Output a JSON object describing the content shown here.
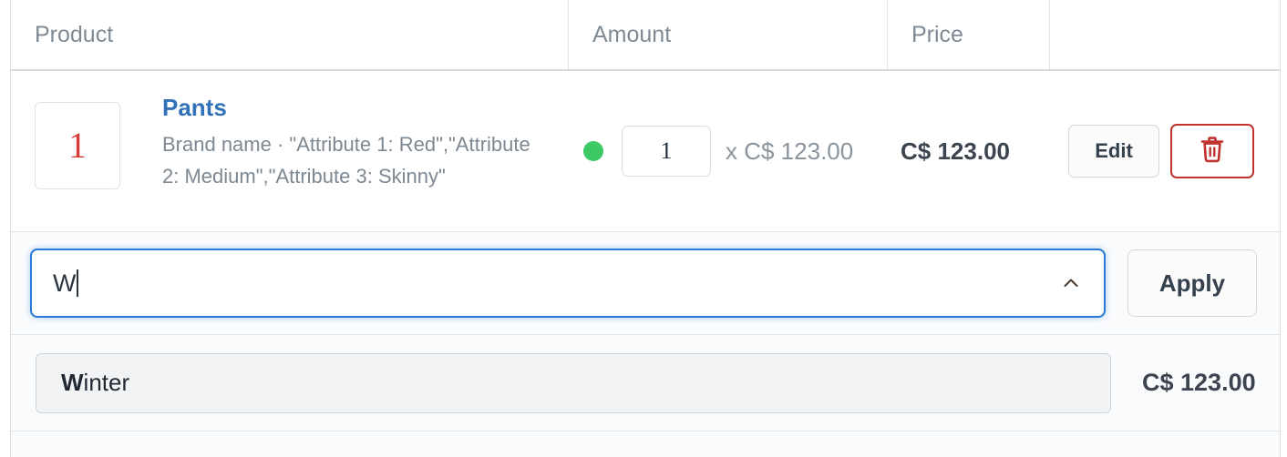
{
  "table": {
    "columns": [
      {
        "key": "product",
        "label": "Product"
      },
      {
        "key": "amount",
        "label": "Amount"
      },
      {
        "key": "price",
        "label": "Price"
      },
      {
        "key": "actions",
        "label": ""
      }
    ],
    "rows": [
      {
        "thumbnail_text": "1",
        "name": "Pants",
        "description": "Brand name · \"Attribute 1: Red\",\"Attribute 2: Medium\",\"Attribute 3: Skinny\"",
        "stock_status": "in-stock",
        "quantity": "1",
        "unit_price": "x C$ 123.00",
        "line_total": "C$ 123.00",
        "edit_label": "Edit",
        "delete_icon": "trash-icon"
      }
    ]
  },
  "coupon": {
    "value": "W",
    "placeholder": "",
    "toggle_icon": "chevron-up-icon",
    "apply_label": "Apply"
  },
  "suggestions": {
    "items": [
      {
        "matched_prefix": "W",
        "rest": "inter",
        "amount": "C$ 123.00"
      }
    ]
  },
  "colors": {
    "link": "#3071b9",
    "in_stock_dot": "#3ec967",
    "delete_border": "#c0322e",
    "focus_border": "#2a7ad4",
    "thumbnail_number": "#d93a35"
  }
}
